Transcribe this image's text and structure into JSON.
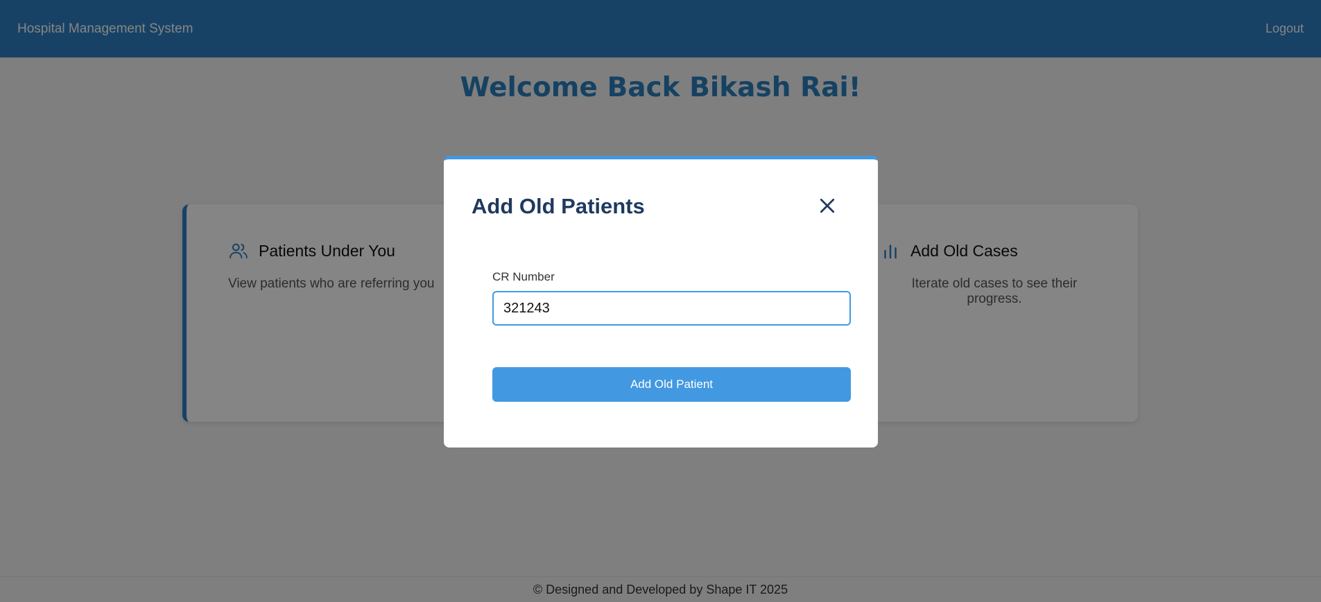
{
  "navbar": {
    "brand": "Hospital Management System",
    "logout_label": "Logout"
  },
  "welcome": {
    "title": "Welcome Back Bikash Rai!"
  },
  "cards": [
    {
      "title": "Patients Under You",
      "description": "View patients who are referring you",
      "icon": "users-icon"
    },
    {
      "title": "Add Old Cases",
      "description": "Iterate old cases to see their progress.",
      "icon": "bar-chart-icon"
    }
  ],
  "modal": {
    "title": "Add Old Patients",
    "field_label": "CR Number",
    "field_value": "321243",
    "submit_label": "Add Old Patient",
    "close_icon": "close-icon"
  },
  "footer": {
    "text": "© Designed and Developed by Shape IT 2025"
  },
  "colors": {
    "primary": "#2d7fc1",
    "accent": "#4299e1",
    "title": "#1e3a5f",
    "overlay": "rgba(0,0,0,0.48)"
  }
}
